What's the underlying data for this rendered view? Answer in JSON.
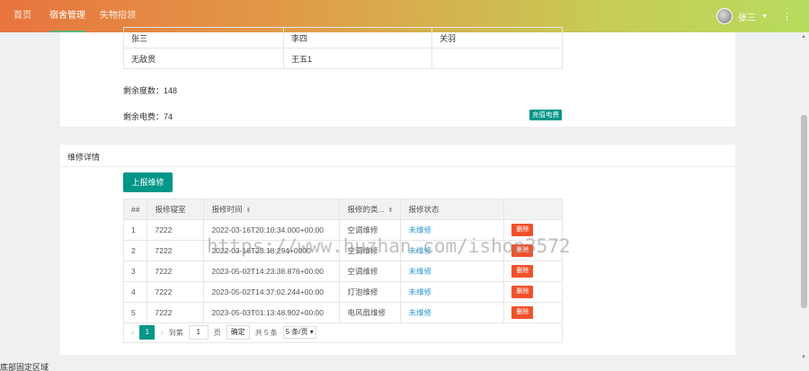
{
  "nav": {
    "items": [
      {
        "label": "首页"
      },
      {
        "label": "宿舍管理"
      },
      {
        "label": "失物招领"
      }
    ],
    "user_name": "张三",
    "caret": "▼",
    "more": "⋮"
  },
  "room_table": {
    "rows": [
      [
        "张三",
        "李四",
        "关羽"
      ],
      [
        "无敌贯",
        "王五1",
        ""
      ]
    ]
  },
  "stats": {
    "remaining_degrees": "剩余度数：148",
    "remaining_fee": "剩余电费：74",
    "recharge_button": "充值电费"
  },
  "repair": {
    "title": "维修详情",
    "report_button": "上报维修",
    "headers": [
      "##",
      "报修寝室",
      "报修时间",
      "报修的类...",
      "报修状态",
      ""
    ],
    "rows": [
      {
        "no": "1",
        "room": "7222",
        "time": "2022-03-16T20:10:34.000+00:00",
        "type": "空调维修",
        "status": "未维修",
        "action": "删除"
      },
      {
        "no": "2",
        "room": "7222",
        "time": "2022-03-16T23:18:294+0000",
        "type": "空调维修",
        "status": "未维修",
        "action": "删除"
      },
      {
        "no": "3",
        "room": "7222",
        "time": "2023-05-02T14:23:38.876+00:00",
        "type": "空调维修",
        "status": "未维修",
        "action": "删除"
      },
      {
        "no": "4",
        "room": "7222",
        "time": "2023-05-02T14:37:02.244+00:00",
        "type": "灯泡维修",
        "status": "未维修",
        "action": "删除"
      },
      {
        "no": "5",
        "room": "7222",
        "time": "2023-05-03T01:13:48.902+00:00",
        "type": "电风扇维修",
        "status": "未维修",
        "action": "删除"
      }
    ],
    "pager": {
      "prev": "‹",
      "current": "1",
      "next": "›",
      "goto_label": "到第",
      "goto_value": "1",
      "page_unit": "页",
      "confirm": "确定",
      "total": "共 5 条",
      "page_size": "5 条/页 ▾"
    }
  },
  "footer": "底部固定区域",
  "watermark": "https://www.huzhan.com/ishop3572",
  "colors": {
    "primary": "#009688",
    "danger": "#f2522b",
    "link": "#2d9ad6",
    "header_from": "#e8743e",
    "header_to": "#b7dc5e"
  }
}
